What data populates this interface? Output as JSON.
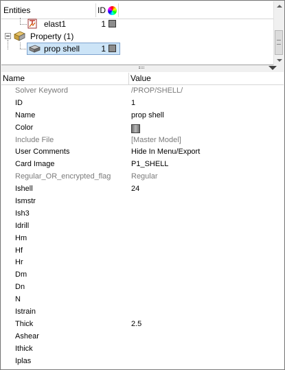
{
  "tree": {
    "headers": {
      "entities": "Entities",
      "id": "ID"
    },
    "rows": [
      {
        "label": "elast1",
        "id": "1"
      },
      {
        "label": "Property (1)"
      },
      {
        "label": "prop shell",
        "id": "1"
      }
    ]
  },
  "grid": {
    "headers": {
      "name": "Name",
      "value": "Value"
    },
    "rows": [
      {
        "name": "Solver Keyword",
        "value": "/PROP/SHELL/"
      },
      {
        "name": "ID",
        "value": "1"
      },
      {
        "name": "Name",
        "value": "prop shell"
      },
      {
        "name": "Color",
        "value": ""
      },
      {
        "name": "Include File",
        "value": "[Master Model]"
      },
      {
        "name": "User Comments",
        "value": "Hide In Menu/Export"
      },
      {
        "name": "Card Image",
        "value": "P1_SHELL"
      },
      {
        "name": "Regular_OR_encrypted_flag",
        "value": "Regular"
      },
      {
        "name": "Ishell",
        "value": "24"
      },
      {
        "name": "Ismstr",
        "value": ""
      },
      {
        "name": "Ish3",
        "value": ""
      },
      {
        "name": "Idrill",
        "value": ""
      },
      {
        "name": "Hm",
        "value": ""
      },
      {
        "name": "Hf",
        "value": ""
      },
      {
        "name": "Hr",
        "value": ""
      },
      {
        "name": "Dm",
        "value": ""
      },
      {
        "name": "Dn",
        "value": ""
      },
      {
        "name": "N",
        "value": ""
      },
      {
        "name": "Istrain",
        "value": ""
      },
      {
        "name": "Thick",
        "value": "2.5"
      },
      {
        "name": "Ashear",
        "value": ""
      },
      {
        "name": "Ithick",
        "value": ""
      },
      {
        "name": "Iplas",
        "value": ""
      }
    ]
  },
  "colors": {
    "selection_bg": "#cce4f7",
    "selection_border": "#7da2ce",
    "readonly_text": "#7a7a7a",
    "entity_swatch": "#8c8c8c"
  }
}
